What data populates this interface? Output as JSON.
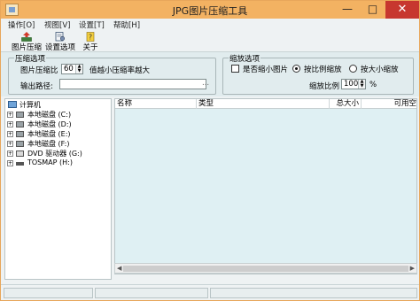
{
  "window": {
    "title": "JPG图片压缩工具"
  },
  "controls": {
    "minimize": "—",
    "maximize": "□",
    "close": "✕"
  },
  "menu": [
    "操作[O]",
    "视图[V]",
    "设置[T]",
    "帮助[H]"
  ],
  "toolbar": [
    {
      "label": "图片压缩",
      "icon": "compress-icon"
    },
    {
      "label": "设置选项",
      "icon": "settings-icon"
    },
    {
      "label": "关于",
      "icon": "about-icon"
    }
  ],
  "compress_options": {
    "legend": "压缩选项",
    "ratio_label": "图片压缩比",
    "ratio_value": "60",
    "hint": "值越小压缩率越大",
    "output_label": "输出路径:",
    "output_value": "",
    "browse_label": "..."
  },
  "scale_options": {
    "legend": "缩放选项",
    "thumbnail_label": "是否缩小图片",
    "thumbnail_checked": false,
    "proportional_label": "按比例缩放",
    "proportional_selected": true,
    "size_label": "按大小缩放",
    "size_selected": false,
    "scale_label": "缩放比例",
    "scale_value": "100",
    "scale_unit": "%"
  },
  "tree": {
    "root": "计算机",
    "items": [
      {
        "label": "本地磁盘 (C:)"
      },
      {
        "label": "本地磁盘 (D:)"
      },
      {
        "label": "本地磁盘 (E:)"
      },
      {
        "label": "本地磁盘 (F:)"
      },
      {
        "label": "DVD 驱动器 (G:)"
      },
      {
        "label": "TOSMAP (H:)"
      }
    ]
  },
  "file_list": {
    "columns": [
      "名称",
      "类型",
      "总大小",
      "可用空"
    ]
  },
  "status": [
    "",
    "",
    ""
  ]
}
